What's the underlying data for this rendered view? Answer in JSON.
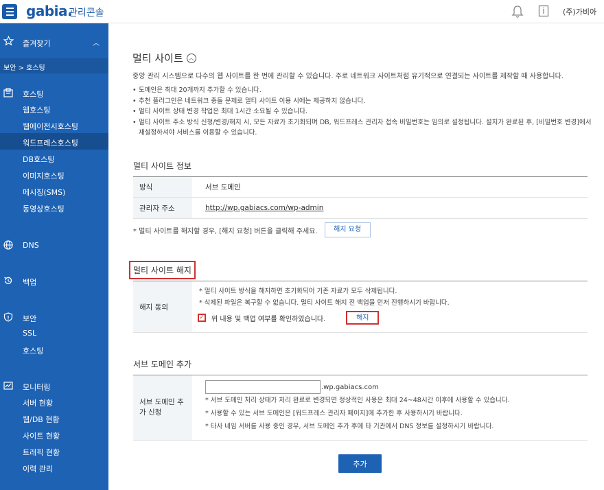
{
  "header": {
    "logo": "gabia.",
    "logo_sub": "관리콘솔",
    "user": "(주)가비아"
  },
  "sidebar": {
    "favorites": "즐겨찾기",
    "breadcrumb": "보안 > 호스팅",
    "sections": [
      {
        "label": "호스팅",
        "items": [
          "웹호스팅",
          "웹에이전시호스팅",
          "워드프레스호스팅",
          "DB호스팅",
          "이미지호스팅",
          "메시징(SMS)",
          "동영상호스팅"
        ],
        "active": 2
      },
      {
        "label": "DNS",
        "items": []
      },
      {
        "label": "백업",
        "items": []
      },
      {
        "label": "보안",
        "items": [
          "SSL",
          "호스팅"
        ]
      },
      {
        "label": "모니터링",
        "items": [
          "서버 현황",
          "웹/DB 현황",
          "사이트 현황",
          "트래픽 현황",
          "이력 관리"
        ]
      }
    ]
  },
  "page": {
    "title": "멀티 사이트",
    "description": "중앙 관리 시스템으로 다수의 웹 사이트를 한 번에 관리할 수 있습니다. 주로 네트워크 사이트처럼 유기적으로 연결되는 사이트를 제작할 때 사용합니다.",
    "bullets": [
      "도메인은 최대 20개까지 추가할 수 있습니다.",
      "추천 플러그인은 네트워크 충돌 문제로 멀티 사이트 이용 시에는 제공하지 않습니다.",
      "멀티 사이트 상태 변경 작업은 최대 1시간 소요될 수 있습니다.",
      "멀티 사이트 주소 방식 신청/변경/해지 시, 모든 자료가 초기화되며 DB, 워드프레스 관리자 접속 비밀번호는 임의로 설정됩니다. 설치가 완료된 후, [비밀번호 변경]에서 재설정하셔야 서비스를 이용할 수 있습니다."
    ]
  },
  "info": {
    "title": "멀티 사이트 정보",
    "method_label": "방식",
    "method_value": "서브 도메인",
    "admin_label": "관리자 주소",
    "admin_value": "http://wp.gabiacs.com/wp-admin",
    "note": "* 멀티 사이트를 해지할 경우, [해지 요청] 버튼을 클릭해 주세요.",
    "cancel_request": "해지 요청"
  },
  "cancel": {
    "title": "멀티 사이트 해지",
    "label": "해지 동의",
    "notes": [
      "* 멀티 사이트 방식을 해지하면 초기화되어 기존 자료가 모두 삭제됩니다.",
      "* 삭제된 파일은 복구할 수 없습니다. 멀티 사이트 해지 전 백업을 먼저 진행하시기 바랍니다."
    ],
    "confirm": "위 내용 및 백업 여부를 확인하였습니다.",
    "button": "해지"
  },
  "subdomain": {
    "title": "서브 도메인 추가",
    "label": "서브 도메인 추가 신청",
    "suffix": ".wp.gabiacs.com",
    "input_value": "",
    "notes": [
      "* 서브 도메인 처리 상태가 처리 완료로 변경되면 정상적인 사용은 최대 24~48시간 이후에 사용할 수 있습니다.",
      "* 사용할 수 있는 서브 도메인은 [워드프레스 관리자 페이지]에 추가한 후 사용하시기 바랍니다.",
      "* 타사 네임 서버를 사용 중인 경우, 서브 도메인 추가 후에 타 기관에서 DNS 정보를 설정하시기 바랍니다."
    ],
    "add_button": "추가"
  }
}
